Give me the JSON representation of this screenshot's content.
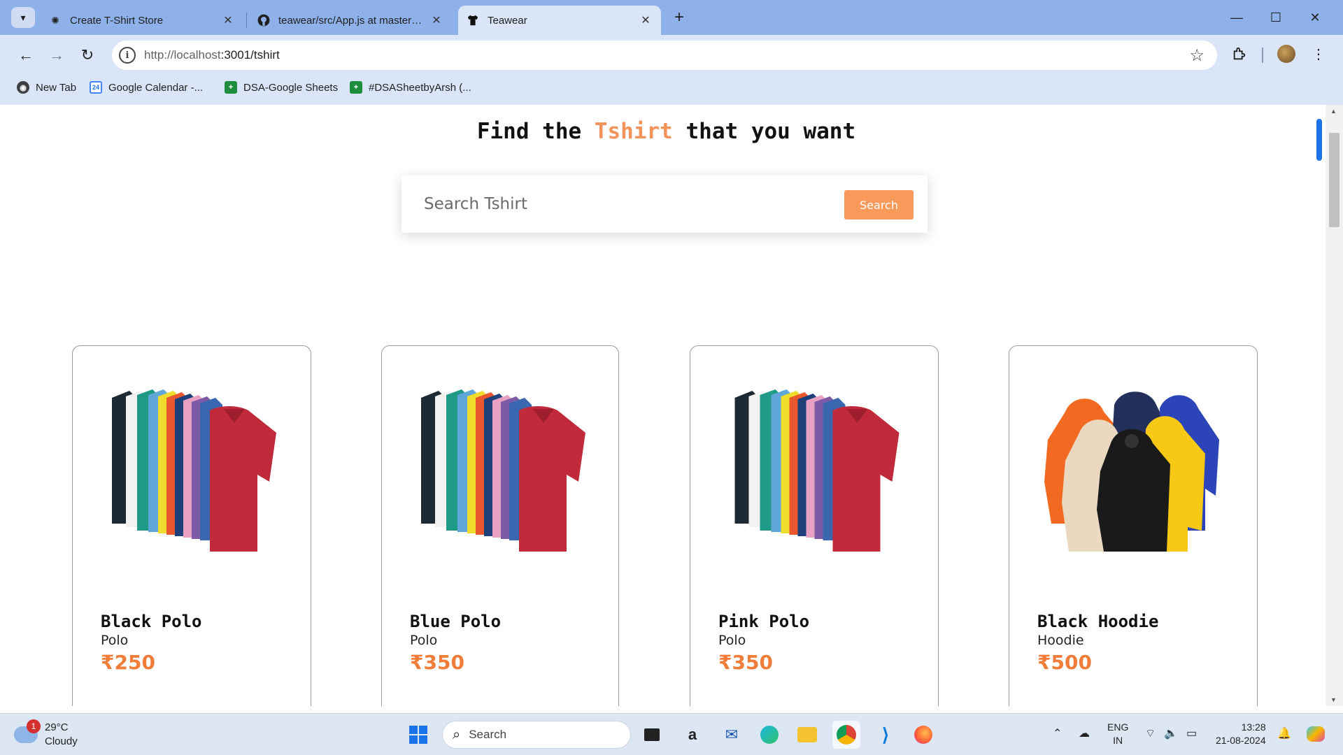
{
  "browser": {
    "tabs": [
      {
        "title": "Create T-Shirt Store",
        "icon": "openai-icon"
      },
      {
        "title": "teawear/src/App.js at master · g",
        "icon": "github-icon"
      },
      {
        "title": "Teawear",
        "icon": "tshirt-icon"
      }
    ],
    "url_host": "http://localhost",
    "url_path": ":3001/tshirt",
    "bookmarks": [
      {
        "label": "New Tab",
        "icon": "globe-icon"
      },
      {
        "label": "Google Calendar -...",
        "icon": "calendar-icon",
        "icon_text": "24"
      },
      {
        "label": "DSA-Google Sheets",
        "icon": "sheets-icon"
      },
      {
        "label": "#DSASheetbyArsh (...",
        "icon": "sheets-icon"
      }
    ]
  },
  "page": {
    "title_before": "Find the",
    "title_accent": "Tshirt",
    "title_after": "that you want",
    "accent_color": "#f3935a",
    "search": {
      "placeholder": "Search Tshirt",
      "button_label": "Search"
    },
    "products": [
      {
        "name": "Black Polo",
        "category": "Polo",
        "price": "₹250",
        "image": "polo-shirts"
      },
      {
        "name": "Blue Polo",
        "category": "Polo",
        "price": "₹350",
        "image": "polo-shirts"
      },
      {
        "name": "Pink Polo",
        "category": "Polo",
        "price": "₹350",
        "image": "polo-shirts"
      },
      {
        "name": "Black Hoodie",
        "category": "Hoodie",
        "price": "₹500",
        "image": "hoodies"
      }
    ]
  },
  "taskbar": {
    "weather_temp": "29°C",
    "weather_desc": "Cloudy",
    "weather_badge": "1",
    "search_placeholder": "Search",
    "lang_line1": "ENG",
    "lang_line2": "IN",
    "time": "13:28",
    "date": "21-08-2024"
  }
}
